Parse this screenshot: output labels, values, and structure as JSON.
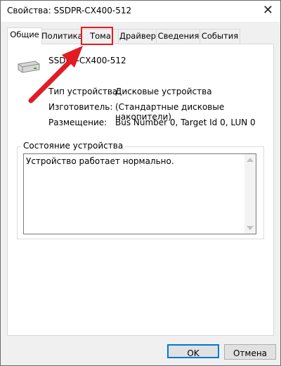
{
  "window": {
    "title": "Свойства: SSDPR-CX400-512",
    "close_icon": "close-icon"
  },
  "tabs": [
    {
      "label": "Общие",
      "active": true
    },
    {
      "label": "Политика",
      "active": false
    },
    {
      "label": "Тома",
      "active": false,
      "highlighted": true
    },
    {
      "label": "Драйвер",
      "active": false
    },
    {
      "label": "Сведения",
      "active": false
    },
    {
      "label": "События",
      "active": false
    }
  ],
  "general": {
    "device_name": "SSDPR-CX400-512",
    "device_icon": "drive-icon",
    "properties": [
      {
        "label": "Тип устройства:",
        "value": "Дисковые устройства"
      },
      {
        "label": "Изготовитель:",
        "value": "(Стандартные дисковые накопители)"
      },
      {
        "label": "Размещение:",
        "value": "Bus Number 0, Target Id 0, LUN 0"
      }
    ],
    "status_group_title": "Состояние устройства",
    "status_text": "Устройство работает нормально."
  },
  "buttons": {
    "ok": "OK",
    "cancel": "Отмена"
  },
  "annotation": {
    "highlight_color": "#e31b23",
    "arrow_color": "#e31b23"
  },
  "colors": {
    "accent": "#0078d7",
    "window_bg": "#f0f0f0"
  }
}
